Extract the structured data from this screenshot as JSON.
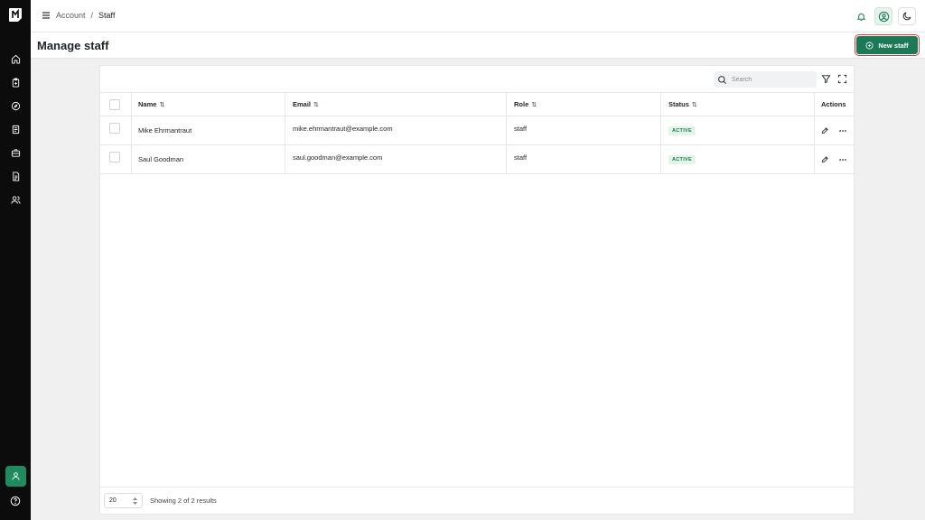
{
  "breadcrumb": {
    "parent": "Account",
    "separator": "/",
    "current": "Staff"
  },
  "page": {
    "title": "Manage staff",
    "new_button_label": "New staff"
  },
  "toolbar": {
    "search_placeholder": "Search"
  },
  "table": {
    "headers": {
      "name": "Name",
      "email": "Email",
      "role": "Role",
      "status": "Status",
      "actions": "Actions"
    },
    "sort_glyph": "⇅",
    "rows": [
      {
        "name": "Mike Ehrmantraut",
        "email": "mike.ehrmantraut@example.com",
        "role": "staff",
        "status": "ACTIVE"
      },
      {
        "name": "Saul Goodman",
        "email": "saul.goodman@example.com",
        "role": "staff",
        "status": "ACTIVE"
      }
    ]
  },
  "footer": {
    "page_size": "20",
    "showing": "Showing 2 of 2 results"
  },
  "colors": {
    "accent": "#1b7a55",
    "sidebar": "#0c0c0c",
    "badge_text": "#1d7a4e",
    "badge_bg": "#e3f4ea",
    "highlight_outline": "#d23b3b"
  },
  "icons": {
    "sidebar": [
      "home-icon",
      "clipboard-icon",
      "compass-icon",
      "receipt-icon",
      "briefcase-icon",
      "document-icon",
      "users-icon"
    ],
    "top": [
      "bell-icon",
      "user-circle-icon",
      "moon-icon"
    ]
  }
}
